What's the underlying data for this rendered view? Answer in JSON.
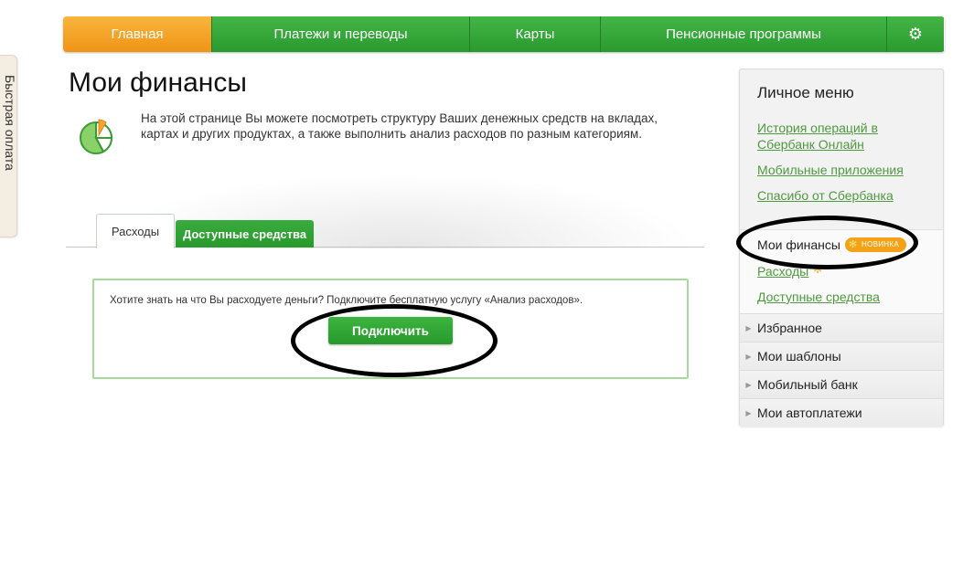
{
  "quickpay": {
    "label": "Быстрая оплата"
  },
  "nav": {
    "items": [
      "Главная",
      "Платежи и переводы",
      "Карты",
      "Пенсионные программы"
    ],
    "settings_icon": "gear-icon"
  },
  "page": {
    "title": "Мои финансы",
    "intro": "На этой странице Вы можете посмотреть структуру Ваших денежных средств на вкладах, картах и других продуктах, а также выполнить анализ расходов по разным категориям.",
    "icon": "pie-chart-icon"
  },
  "tabs": [
    "Расходы",
    "Доступные средства"
  ],
  "infobox": {
    "text": "Хотите знать на что Вы расходуете деньги? Подключите бесплатную услугу «Анализ расходов».",
    "button": "Подключить"
  },
  "sidebar": {
    "title": "Личное меню",
    "links": [
      "История операций в Сбербанк Онлайн",
      "Мобильные приложения",
      "Спасибо от Сбербанка"
    ],
    "active": {
      "label": "Мои финансы",
      "badge": "НОВИНКА",
      "subitems": [
        "Расходы",
        "Доступные средства"
      ]
    },
    "rows": [
      "Избранное",
      "Мои шаблоны",
      "Мобильный банк",
      "Мои автоплатежи"
    ]
  },
  "colors": {
    "green": "#2fa533",
    "orange": "#f7a428",
    "link": "#4e9a3e",
    "badge": "#f4a319"
  }
}
